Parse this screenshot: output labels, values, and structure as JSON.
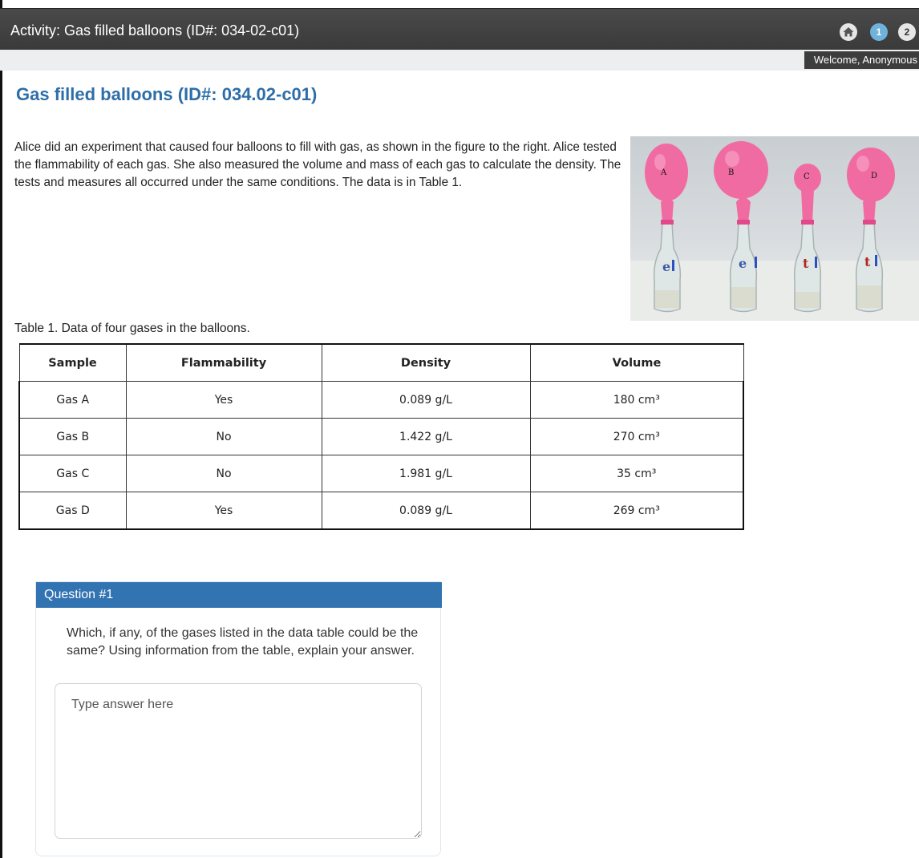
{
  "header": {
    "title": "Activity: Gas filled balloons (ID#: 034-02-c01)",
    "nav_one": "1",
    "nav_two": "2",
    "welcome": "Welcome, Anonymous"
  },
  "main": {
    "heading": "Gas filled balloons (ID#: 034.02-c01)",
    "intro": "Alice did an experiment that caused four balloons to fill with gas, as shown in the figure to the right. Alice tested the flammability of each gas. She also measured the volume and mass of each gas to calculate the density. The tests and measures all occurred under the same conditions. The data is in Table 1.",
    "figure_labels": [
      "A",
      "B",
      "C",
      "D"
    ],
    "table_caption": "Table 1. Data of four gases in the balloons.",
    "table": {
      "headers": [
        "Sample",
        "Flammability",
        "Density",
        "Volume"
      ],
      "rows": [
        {
          "sample": "Gas A",
          "flammability": "Yes",
          "density": "0.089 g/L",
          "volume": "180 cm³"
        },
        {
          "sample": "Gas B",
          "flammability": "No",
          "density": "1.422  g/L",
          "volume": "270 cm³"
        },
        {
          "sample": "Gas C",
          "flammability": "No",
          "density": "1.981 g/L",
          "volume": "35 cm³"
        },
        {
          "sample": "Gas D",
          "flammability": "Yes",
          "density": "0.089 g/L",
          "volume": "269 cm³"
        }
      ]
    }
  },
  "question": {
    "header": "Question #1",
    "text": "Which, if any, of the gases listed in the data table could be the same? Using information from the table, explain your answer.",
    "answer_placeholder": "Type answer here",
    "answer_value": ""
  },
  "colors": {
    "title_blue": "#2d6ea8",
    "question_header": "#3273b1",
    "top_bar": "#3f3f3f",
    "balloon_pink": "#f06ba2"
  },
  "icons": [
    "home-icon"
  ]
}
